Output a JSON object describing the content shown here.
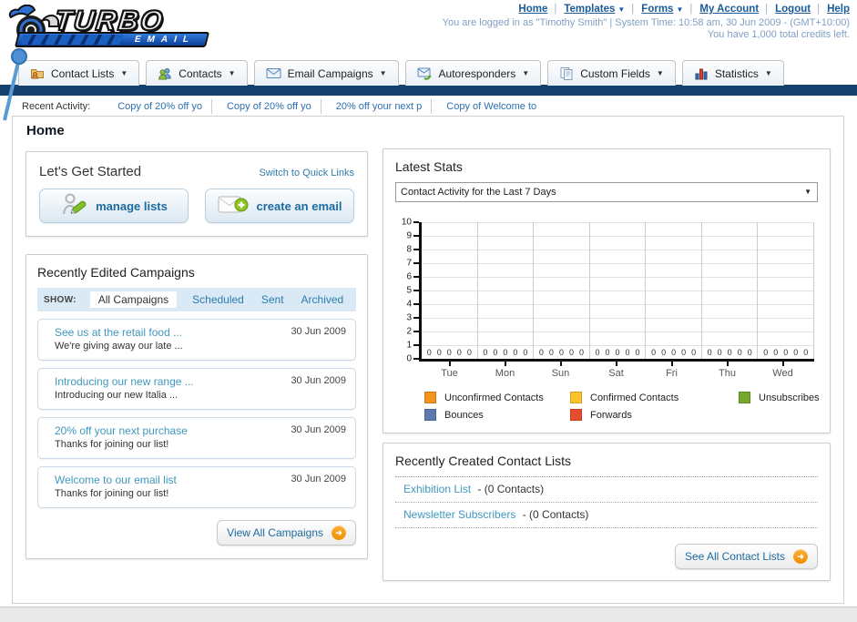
{
  "brand": {
    "name": "TURBO",
    "sub": "EMAIL"
  },
  "top_nav": {
    "links": [
      {
        "label": "Home",
        "dropdown": false
      },
      {
        "label": "Templates",
        "dropdown": true
      },
      {
        "label": "Forms",
        "dropdown": true
      },
      {
        "label": "My Account",
        "dropdown": false
      },
      {
        "label": "Logout",
        "dropdown": false
      },
      {
        "label": "Help",
        "dropdown": false
      }
    ],
    "status_line": "You are logged in as \"Timothy Smith\" | System Time: 10:58 am, 30 Jun 2009 - (GMT+10:00)",
    "credits_line": "You have 1,000 total credits left."
  },
  "main_nav": {
    "tabs": [
      {
        "label": "Contact Lists",
        "icon": "contact-lists-icon"
      },
      {
        "label": "Contacts",
        "icon": "contacts-icon"
      },
      {
        "label": "Email Campaigns",
        "icon": "email-campaigns-icon"
      },
      {
        "label": "Autoresponders",
        "icon": "autoresponders-icon"
      },
      {
        "label": "Custom Fields",
        "icon": "custom-fields-icon"
      },
      {
        "label": "Statistics",
        "icon": "statistics-icon"
      }
    ]
  },
  "recent_activity": {
    "label": "Recent Activity:",
    "items": [
      {
        "label": "Copy of 20% off yo"
      },
      {
        "label": "Copy of 20% off yo"
      },
      {
        "label": "20% off your next p"
      },
      {
        "label": "Copy of Welcome to"
      }
    ]
  },
  "page_title": "Home",
  "get_started": {
    "title": "Let's Get Started",
    "switch_link": "Switch to Quick Links",
    "manage_lists_label": "manage lists",
    "create_email_label": "create an email"
  },
  "campaigns": {
    "title": "Recently Edited Campaigns",
    "show_label": "SHOW:",
    "filters": [
      {
        "label": "All Campaigns",
        "active": true
      },
      {
        "label": "Scheduled",
        "active": false
      },
      {
        "label": "Sent",
        "active": false
      },
      {
        "label": "Archived",
        "active": false
      }
    ],
    "items": [
      {
        "title": "See us at the retail food ...",
        "subtitle": "We're giving away our late ...",
        "date": "30 Jun 2009"
      },
      {
        "title": "Introducing our new range ...",
        "subtitle": "Introducing our new Italia ...",
        "date": "30 Jun 2009"
      },
      {
        "title": "20% off your next purchase",
        "subtitle": "Thanks for joining our list!",
        "date": "30 Jun 2009"
      },
      {
        "title": "Welcome to our email list",
        "subtitle": "Thanks for joining our list!",
        "date": "30 Jun 2009"
      }
    ],
    "view_all_label": "View All Campaigns"
  },
  "stats": {
    "title": "Latest Stats",
    "dropdown_value": "Contact Activity for the Last 7 Days"
  },
  "chart_data": {
    "type": "bar",
    "title": "Contact Activity for the Last 7 Days",
    "categories": [
      "Tue",
      "Mon",
      "Sun",
      "Sat",
      "Fri",
      "Thu",
      "Wed"
    ],
    "series": [
      {
        "name": "Unconfirmed Contacts",
        "color": "#F6921E",
        "values": [
          0,
          0,
          0,
          0,
          0,
          0,
          0
        ]
      },
      {
        "name": "Confirmed Contacts",
        "color": "#FDC32C",
        "values": [
          0,
          0,
          0,
          0,
          0,
          0,
          0
        ]
      },
      {
        "name": "Unsubscribes",
        "color": "#76A72E",
        "values": [
          0,
          0,
          0,
          0,
          0,
          0,
          0
        ]
      },
      {
        "name": "Bounces",
        "color": "#5C79B0",
        "values": [
          0,
          0,
          0,
          0,
          0,
          0,
          0
        ]
      },
      {
        "name": "Forwards",
        "color": "#E54D2B",
        "values": [
          0,
          0,
          0,
          0,
          0,
          0,
          0
        ]
      }
    ],
    "ylim": [
      0,
      10
    ],
    "yticks": [
      0,
      1,
      2,
      3,
      4,
      5,
      6,
      7,
      8,
      9,
      10
    ],
    "grid": true,
    "legend_position": "bottom"
  },
  "contact_lists": {
    "title": "Recently Created Contact Lists",
    "items": [
      {
        "name": "Exhibition List",
        "count": "- (0 Contacts)"
      },
      {
        "name": "Newsletter Subscribers",
        "count": "- (0 Contacts)"
      }
    ],
    "see_all_label": "See All Contact Lists"
  }
}
